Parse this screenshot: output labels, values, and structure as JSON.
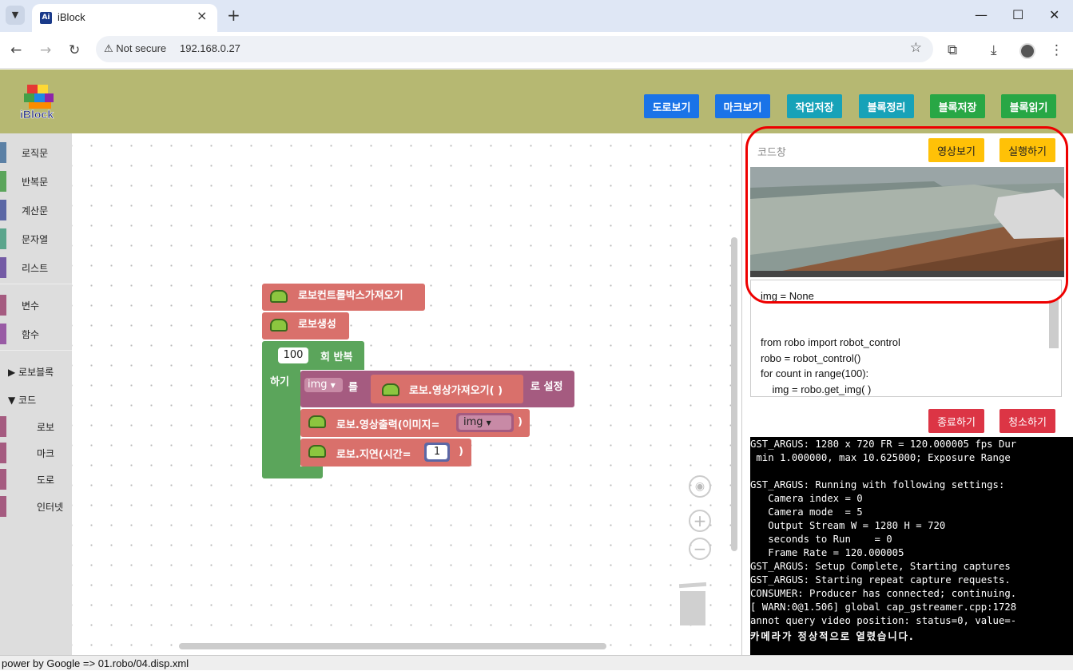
{
  "browser": {
    "tab_title": "iBlock",
    "tab_icon": "Ai",
    "not_secure": "Not secure",
    "url": "192.168.0.27",
    "new_tab": "+",
    "tab_close": "×"
  },
  "header": {
    "logo_text": "iBlock",
    "buttons": [
      "도로보기",
      "마크보기",
      "작업저장",
      "블록정리",
      "블록저장",
      "블록읽기"
    ],
    "button_colors": [
      "#1a73e8",
      "#1a73e8",
      "#17a2b8",
      "#17a2b8",
      "#28a745",
      "#28a745"
    ]
  },
  "sidebar": {
    "categories": [
      {
        "label": "로직문",
        "color": "#5b80a5"
      },
      {
        "label": "반복문",
        "color": "#5ba55b"
      },
      {
        "label": "계산문",
        "color": "#5b67a5"
      },
      {
        "label": "문자열",
        "color": "#5ba58c"
      },
      {
        "label": "리스트",
        "color": "#745ba5"
      },
      {
        "label": "변수",
        "color": "#a55b80"
      },
      {
        "label": "함수",
        "color": "#995ba5"
      },
      {
        "label": "▶ 로보블록",
        "color": ""
      },
      {
        "label": "▼ 코드",
        "color": ""
      },
      {
        "label": "로보",
        "color": "#a55b80"
      },
      {
        "label": "마크",
        "color": "#a55b80"
      },
      {
        "label": "도로",
        "color": "#a55b80"
      },
      {
        "label": "인터넷",
        "color": "#a55b80"
      }
    ]
  },
  "blocks": {
    "get_controlbox": "로보컨트롤박스가져오기",
    "create_robot": "로보생성",
    "repeat_count": "100",
    "repeat_label": "회 반복",
    "do_label": "하기",
    "var_name": "img",
    "set_particle": "를",
    "get_image": "로보.영상가져오기(  )",
    "set_suffix": "로 설정",
    "show_image": "로보.영상출력(이미지=",
    "show_image_var": "img",
    "close_paren": ")",
    "delay": "로보.지연(시간=",
    "delay_value": "1",
    "delay_close": ")"
  },
  "right_panel": {
    "code_label": "코드창",
    "view_video": "영상보기",
    "run": "실행하기",
    "code_lines": [
      "img = None",
      "",
      "",
      "from robo import robot_control",
      "robo = robot_control()",
      "for count in range(100):",
      "    img = robo.get_img( )"
    ],
    "stop": "종료하기",
    "clear": "청소하기",
    "console_lines": [
      "GST_ARGUS: 1280 x 720 FR = 120.000005 fps Dur",
      " min 1.000000, max 10.625000; Exposure Range",
      "",
      "GST_ARGUS: Running with following settings:",
      "   Camera index = 0",
      "   Camera mode  = 5",
      "   Output Stream W = 1280 H = 720",
      "   seconds to Run    = 0",
      "   Frame Rate = 120.000005",
      "GST_ARGUS: Setup Complete, Starting captures",
      "GST_ARGUS: Starting repeat capture requests.",
      "CONSUMER: Producer has connected; continuing.",
      "[ WARN:0@1.506] global cap_gstreamer.cpp:1728",
      "annot query video position: status=0, value=-",
      "카메라가 정상적으로 열렸습니다."
    ]
  },
  "status_bar": "power by Google => 01.robo/04.disp.xml"
}
